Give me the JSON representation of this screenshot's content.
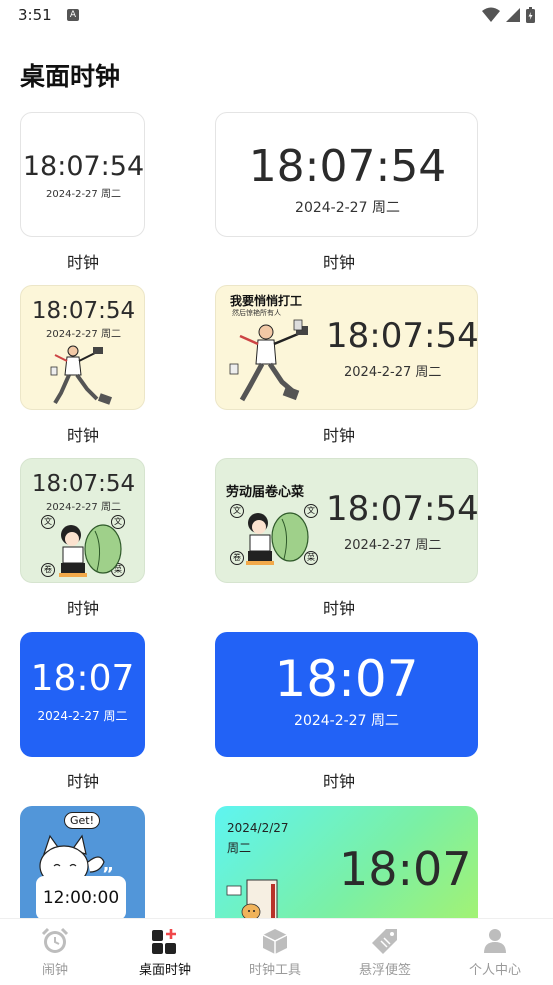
{
  "status_bar": {
    "time": "3:51",
    "notif_letter": "A"
  },
  "page": {
    "title": "桌面时钟"
  },
  "widgets": {
    "w1_small": {
      "time": "18:07:54",
      "date": "2024-2-27 周二",
      "label": "时钟"
    },
    "w1_large": {
      "time": "18:07:54",
      "date": "2024-2-27 周二",
      "label": "时钟"
    },
    "w2_small": {
      "time": "18:07:54",
      "date": "2024-2-27 周二",
      "label": "时钟"
    },
    "w2_large": {
      "time": "18:07:54",
      "date": "2024-2-27 周二",
      "label": "时钟",
      "caption": "我要悄悄打工",
      "subcaption": "然后惊艳所有人"
    },
    "w3_small": {
      "time": "18:07:54",
      "date": "2024-2-27 周二",
      "label": "时钟",
      "stamps": [
        "文",
        "文",
        "卷",
        "菜"
      ]
    },
    "w3_large": {
      "time": "18:07:54",
      "date": "2024-2-27 周二",
      "label": "时钟",
      "caption": "劳动届卷心菜",
      "stamps": [
        "文",
        "文",
        "卷",
        "菜"
      ]
    },
    "w4_small": {
      "time": "18:07",
      "date": "2024-2-27 周二",
      "label": "时钟"
    },
    "w4_large": {
      "time": "18:07",
      "date": "2024-2-27 周二",
      "label": "时钟"
    },
    "w5_small": {
      "time": "12:00:00",
      "bubble": "Get!"
    },
    "w5_large": {
      "date": "2024/2/27",
      "weekday": "周二",
      "time": "18:07"
    }
  },
  "bottom_nav": {
    "items": [
      {
        "label": "闹钟",
        "icon": "alarm-clock-icon"
      },
      {
        "label": "桌面时钟",
        "icon": "widgets-add-icon"
      },
      {
        "label": "时钟工具",
        "icon": "cube-icon"
      },
      {
        "label": "悬浮便签",
        "icon": "tag-icon"
      },
      {
        "label": "个人中心",
        "icon": "person-icon"
      }
    ],
    "active_index": 1
  },
  "colors": {
    "accent_blue": "#2262f6",
    "badge_red": "#f0474a"
  }
}
